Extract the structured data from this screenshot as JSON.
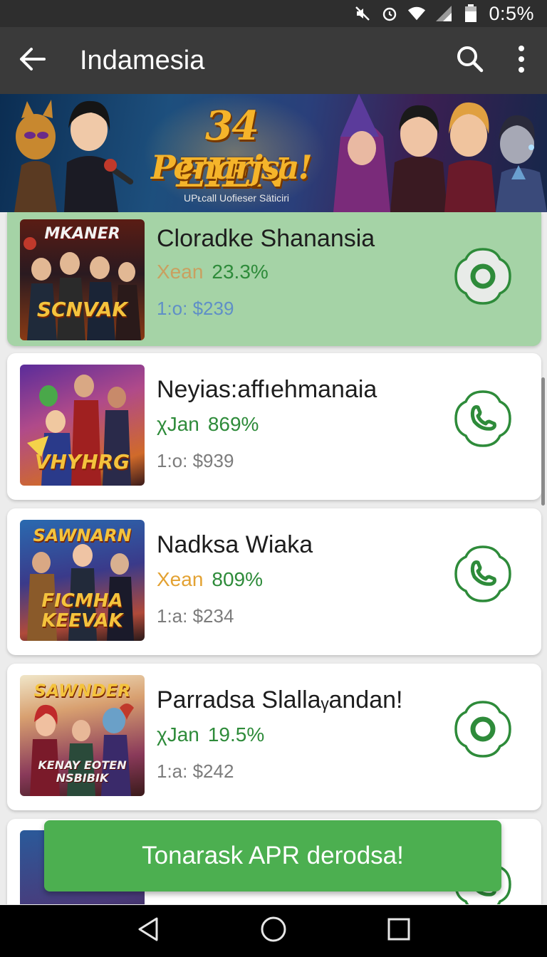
{
  "status_bar": {
    "time_text": "0:5%",
    "icons": [
      "mute-icon",
      "alarm-icon",
      "wifi-icon",
      "signal-icon",
      "battery-icon"
    ]
  },
  "app_bar": {
    "title": "Indamesia",
    "back_icon": "arrow-left-icon",
    "search_icon": "search-icon",
    "menu_icon": "more-vert-icon"
  },
  "banner": {
    "headline_1": "34 EIEN",
    "headline_2": "Penarjsa!",
    "subtitle": "UPᴌcall Uofieser Säticiri"
  },
  "items": [
    {
      "name": "Cloradke Shanansia",
      "rate_label": "Xean",
      "rate_label_color": "#c9a060",
      "rate_value": "23.3%",
      "price": "1:o: $239",
      "thumb_text": "MKANER",
      "thumb_text_2": "SCNVAK",
      "action_icon": "record-icon",
      "selected": true
    },
    {
      "name": "Neyias:affıehmanaia",
      "rate_label": "χJan",
      "rate_label_color": "#2e8b3a",
      "rate_value": "869%",
      "price": "1:o: $939",
      "thumb_text": "VHYHRG",
      "action_icon": "phone-icon",
      "selected": false
    },
    {
      "name": "Nadksa Wiaka",
      "rate_label": "Xean",
      "rate_label_color": "#e3a233",
      "rate_value": "809%",
      "price": "1:a: $234",
      "thumb_text": "SAWNARN",
      "thumb_text_2": "FICMHA KEEVAK",
      "action_icon": "phone-icon",
      "selected": false
    },
    {
      "name": "Parradsa Slallaᵧandan!",
      "rate_label": "χJan",
      "rate_label_color": "#2e8b3a",
      "rate_value": "19.5%",
      "price": "1:a: $242",
      "thumb_text": "SAWNDER",
      "thumb_text_2": "KENAY EOTEN NSBIBIK",
      "action_icon": "record-icon",
      "selected": false
    }
  ],
  "toast": {
    "text": "Tonarask APR derodsa!"
  },
  "nav_bar": {
    "back_icon": "nav-back-icon",
    "home_icon": "nav-home-icon",
    "recents_icon": "nav-recents-icon"
  },
  "colors": {
    "accent_green": "#2e8b3a",
    "selected_card": "#a5d3a6",
    "toast_bg": "#4caf50"
  }
}
